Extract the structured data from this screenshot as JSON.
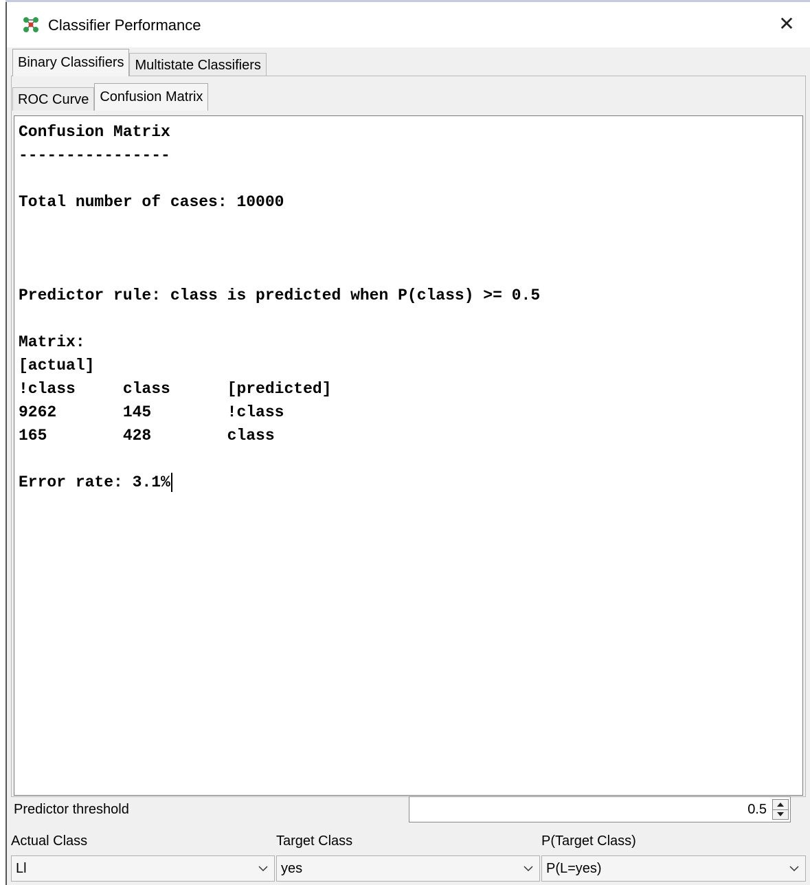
{
  "window": {
    "title": "Classifier Performance",
    "close_glyph": "✕",
    "icon": "network-nodes-icon"
  },
  "tabs_outer": [
    {
      "label": "Binary Classifiers",
      "active": true
    },
    {
      "label": "Multistate Classifiers",
      "active": false
    }
  ],
  "tabs_inner": [
    {
      "label": "ROC Curve",
      "active": false
    },
    {
      "label": "Confusion Matrix",
      "active": true
    }
  ],
  "output": {
    "lines": [
      "Confusion Matrix",
      "----------------",
      "",
      "Total number of cases: 10000",
      "",
      "",
      "",
      "Predictor rule: class is predicted when P(class) >= 0.5",
      "",
      "Matrix:",
      "[actual]",
      "!class     class      [predicted]",
      "9262       145        !class",
      "165        428        class",
      "",
      "Error rate: 3.1%"
    ]
  },
  "controls": {
    "threshold_label": "Predictor threshold",
    "threshold_value": "0.5",
    "actual_class_label": "Actual Class",
    "actual_class_value": "Ll",
    "target_class_label": "Target Class",
    "target_class_value": "yes",
    "p_target_label": "P(Target Class)",
    "p_target_value": "P(L=yes)"
  },
  "colors": {
    "panel_bg": "#f0f0f0",
    "text_area_bg": "#ffffff",
    "border": "#b8b8b8"
  }
}
